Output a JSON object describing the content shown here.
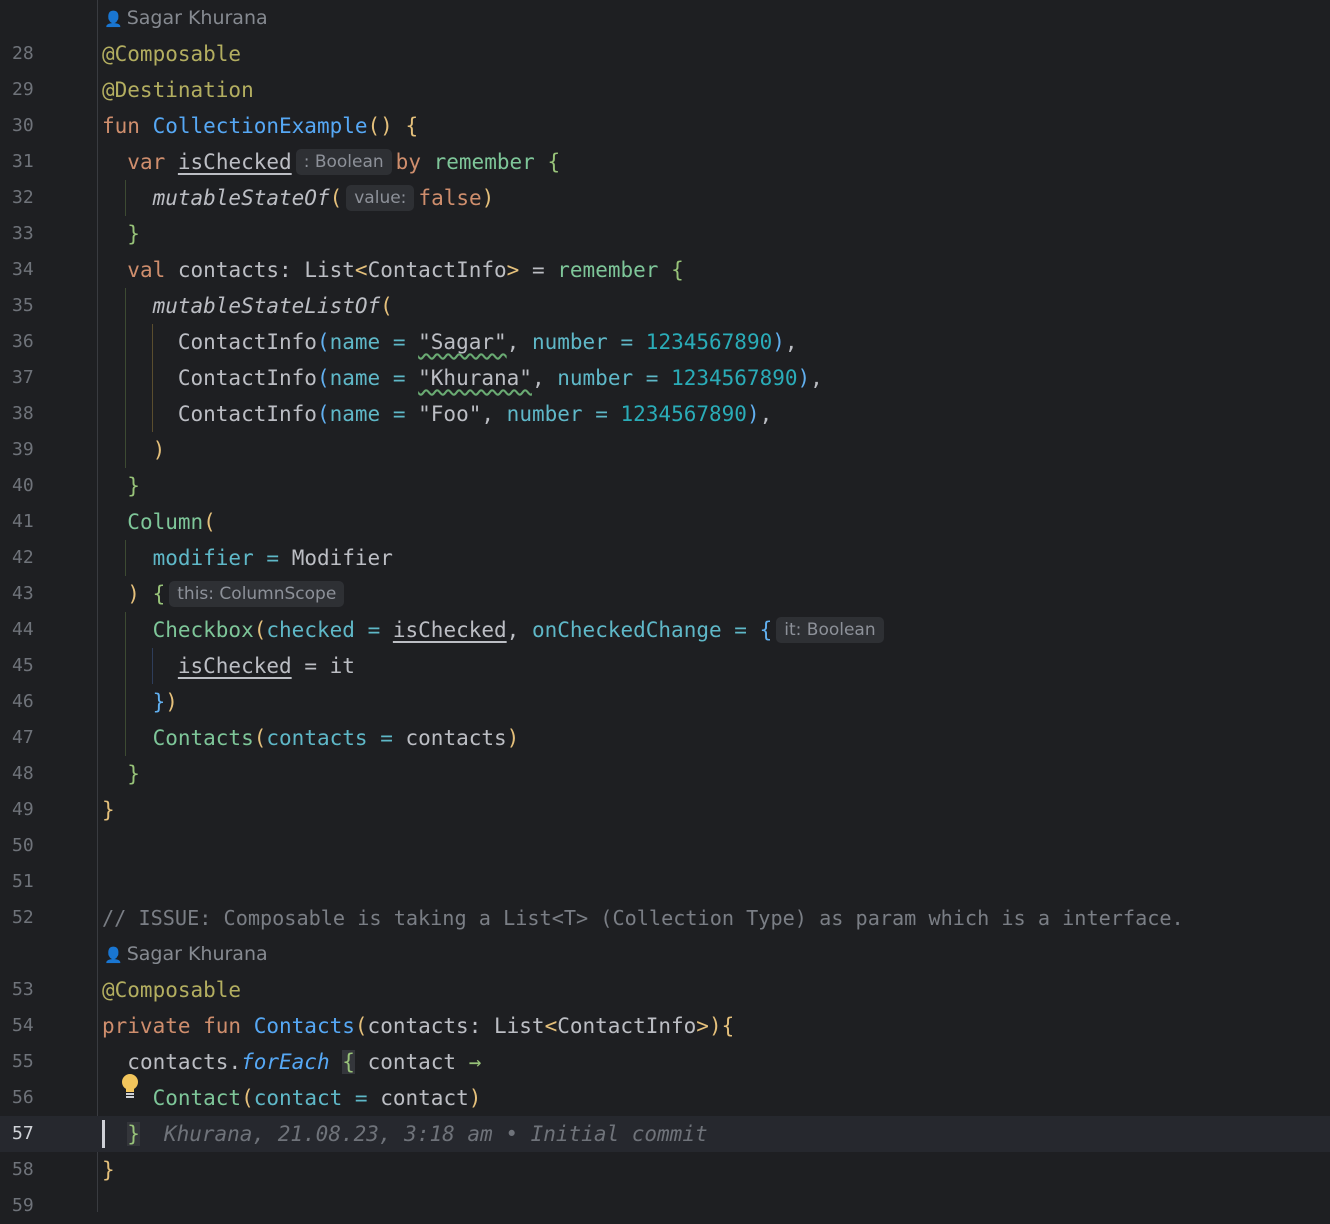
{
  "authors": {
    "top": "Sagar Khurana",
    "mid": "Sagar Khurana"
  },
  "icons": {
    "author": "person-icon",
    "bulb": "lightbulb-icon"
  },
  "hints": {
    "boolean_type": ": Boolean",
    "value_param": "value:",
    "this_scope": "this: ColumnScope",
    "it_boolean": "it: Boolean"
  },
  "blame": {
    "line57": "Khurana, 21.08.23, 3:18 am • Initial commit"
  },
  "line_numbers": [
    "28",
    "29",
    "30",
    "31",
    "32",
    "33",
    "34",
    "35",
    "36",
    "37",
    "38",
    "39",
    "40",
    "41",
    "42",
    "43",
    "44",
    "45",
    "46",
    "47",
    "48",
    "49",
    "50",
    "51",
    "52",
    "53",
    "54",
    "55",
    "56",
    "57",
    "58",
    "59"
  ],
  "code": {
    "l28_ann": "@Composable",
    "l29_ann": "@Destination",
    "l30_kw": "fun",
    "l30_fn": "CollectionExample",
    "l30_paren": "()",
    "l30_brace": "{",
    "l31_kw": "var",
    "l31_var": "isChecked",
    "l31_by": "by",
    "l31_remember": "remember",
    "l31_brace": "{",
    "l32_fn": "mutableStateOf",
    "l32_open": "(",
    "l32_false": "false",
    "l32_close": ")",
    "l33_brace": "}",
    "l34_kw": "val",
    "l34_rest": "contacts: List",
    "l34_lt": "<",
    "l34_type": "ContactInfo",
    "l34_gt": ">",
    "l34_eq": "=",
    "l34_remember": "remember",
    "l34_brace": "{",
    "l35_fn": "mutableStateListOf",
    "l35_open": "(",
    "l36_cls": "ContactInfo",
    "l36_open": "(",
    "l36_name": "name",
    "l36_eq": "=",
    "l36_str": "\"Sagar\"",
    "l36_comma": ",",
    "l36_number": "number",
    "l36_eq2": "=",
    "l36_num": "1234567890",
    "l36_close": ")",
    "l36_end": ",",
    "l37_cls": "ContactInfo",
    "l37_open": "(",
    "l37_name": "name",
    "l37_eq": "=",
    "l37_str": "\"Khurana\"",
    "l37_comma": ",",
    "l37_number": "number",
    "l37_eq2": "=",
    "l37_num": "1234567890",
    "l37_close": ")",
    "l37_end": ",",
    "l38_cls": "ContactInfo",
    "l38_open": "(",
    "l38_name": "name",
    "l38_eq": "=",
    "l38_str": "\"Foo\"",
    "l38_comma": ",",
    "l38_number": "number",
    "l38_eq2": "=",
    "l38_num": "1234567890",
    "l38_close": ")",
    "l38_end": ",",
    "l39_close": ")",
    "l40_brace": "}",
    "l41_fn": "Column",
    "l41_open": "(",
    "l42_param": "modifier",
    "l42_eq": "=",
    "l42_val": "Modifier",
    "l43_close": ")",
    "l43_brace": "{",
    "l44_fn": "Checkbox",
    "l44_open": "(",
    "l44_checked": "checked",
    "l44_eq": "=",
    "l44_var": "isChecked",
    "l44_comma": ",",
    "l44_param": "onCheckedChange",
    "l44_eq2": "=",
    "l44_brace": "{",
    "l45_var": "isChecked",
    "l45_rest": "= it",
    "l46_brace": "}",
    "l46_close": ")",
    "l47_fn": "Contacts",
    "l47_open": "(",
    "l47_param": "contacts",
    "l47_eq": "=",
    "l47_val": "contacts",
    "l47_close": ")",
    "l48_brace": "}",
    "l49_brace": "}",
    "l52_comment": "// ISSUE: Composable is taking a List<T> (Collection Type) as param which is a interface.",
    "l53_ann": "@Composable",
    "l54_kw": "private fun",
    "l54_fn": "Contacts",
    "l54_open": "(",
    "l54_rest": "contacts: List",
    "l54_lt": "<",
    "l54_type": "ContactInfo",
    "l54_gt": ">",
    "l54_close": ")",
    "l54_brace": "{",
    "l55_obj": "contacts.",
    "l55_fn": "forEach",
    "l55_brace": "{",
    "l55_rest": "contact",
    "l55_arrow": "→",
    "l56_fn": "Contact",
    "l56_open": "(",
    "l56_param": "contact",
    "l56_eq": "=",
    "l56_val": "contact",
    "l56_close": ")",
    "l57_brace": "}",
    "l58_brace": "}"
  }
}
